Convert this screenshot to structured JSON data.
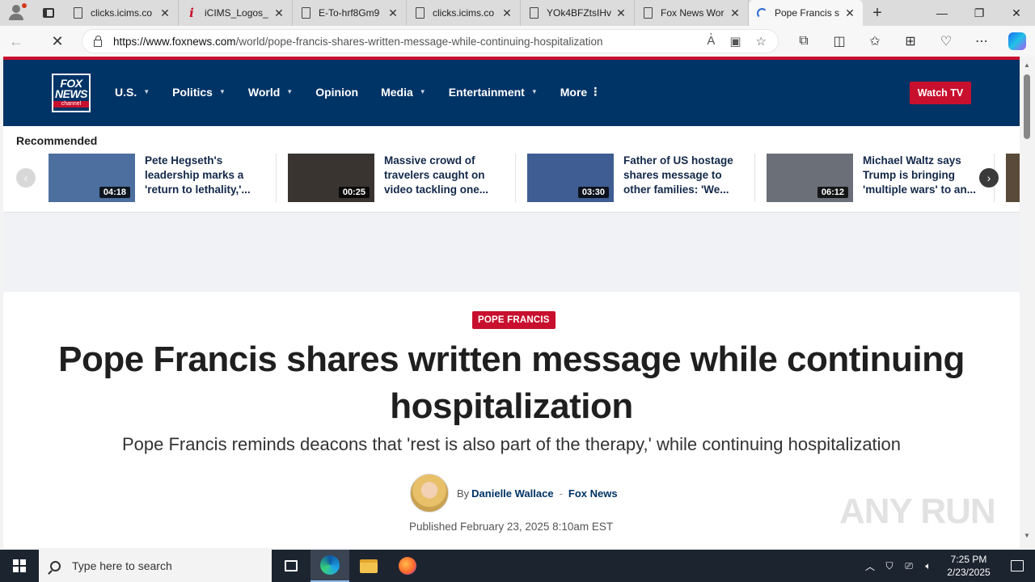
{
  "browser": {
    "tabs": [
      {
        "title": "clicks.icims.co",
        "icon": "document-icon",
        "active": false
      },
      {
        "title": "iCIMS_Logos_",
        "icon": "icims-icon",
        "active": false
      },
      {
        "title": "E-To-hrf8Gm9",
        "icon": "document-icon",
        "active": false
      },
      {
        "title": "clicks.icims.co",
        "icon": "document-icon",
        "active": false
      },
      {
        "title": "YOk4BFZtsIHv",
        "icon": "document-icon",
        "active": false
      },
      {
        "title": "Fox News Wor",
        "icon": "document-icon",
        "active": false
      },
      {
        "title": "Pope Francis s",
        "icon": "loading-icon",
        "active": true
      }
    ],
    "new_tab": "+",
    "window_controls": {
      "minimize": "—",
      "maximize": "❐",
      "close": "✕"
    },
    "url_host": "https://www.foxnews.com",
    "url_path": "/world/pope-francis-shares-written-message-while-continuing-hospitalization"
  },
  "site": {
    "logo": {
      "line1": "FOX",
      "line2": "NEWS",
      "line3": "channel"
    },
    "nav": [
      {
        "label": "U.S.",
        "caret": true
      },
      {
        "label": "Politics",
        "caret": true
      },
      {
        "label": "World",
        "caret": true
      },
      {
        "label": "Opinion",
        "caret": false
      },
      {
        "label": "Media",
        "caret": true
      },
      {
        "label": "Entertainment",
        "caret": true
      },
      {
        "label": "More",
        "caret": false,
        "kebab": true
      }
    ],
    "watch_tv": "Watch TV",
    "accent": "#c8102e",
    "brand": "#003366"
  },
  "recommended": {
    "title": "Recommended",
    "items": [
      {
        "text": "Pete Hegseth's leadership marks a 'return to lethality,'...",
        "duration": "04:18",
        "thumb_bg": "#4d6fa0"
      },
      {
        "text": "Massive crowd of travelers caught on video tackling one...",
        "duration": "00:25",
        "thumb_bg": "#3a3431"
      },
      {
        "text": "Father of US hostage shares message to other families: 'We...",
        "duration": "03:30",
        "thumb_bg": "#3f5d92"
      },
      {
        "text": "Michael Waltz says Trump is bringing 'multiple wars' to an...",
        "duration": "06:12",
        "thumb_bg": "#6b6f78"
      }
    ]
  },
  "article": {
    "eyebrow": "POPE FRANCIS",
    "headline": "Pope Francis shares written message while continuing hospitalization",
    "subhead": "Pope Francis reminds deacons that 'rest is also part of the therapy,' while continuing hospitalization",
    "by": "By",
    "author": "Danielle Wallace",
    "separator": "-",
    "outlet": "Fox News",
    "published": "Published February 23, 2025 8:10am EST"
  },
  "watermark": "ANY RUN",
  "taskbar": {
    "search_placeholder": "Type here to search",
    "time": "7:25 PM",
    "date": "2/23/2025"
  }
}
